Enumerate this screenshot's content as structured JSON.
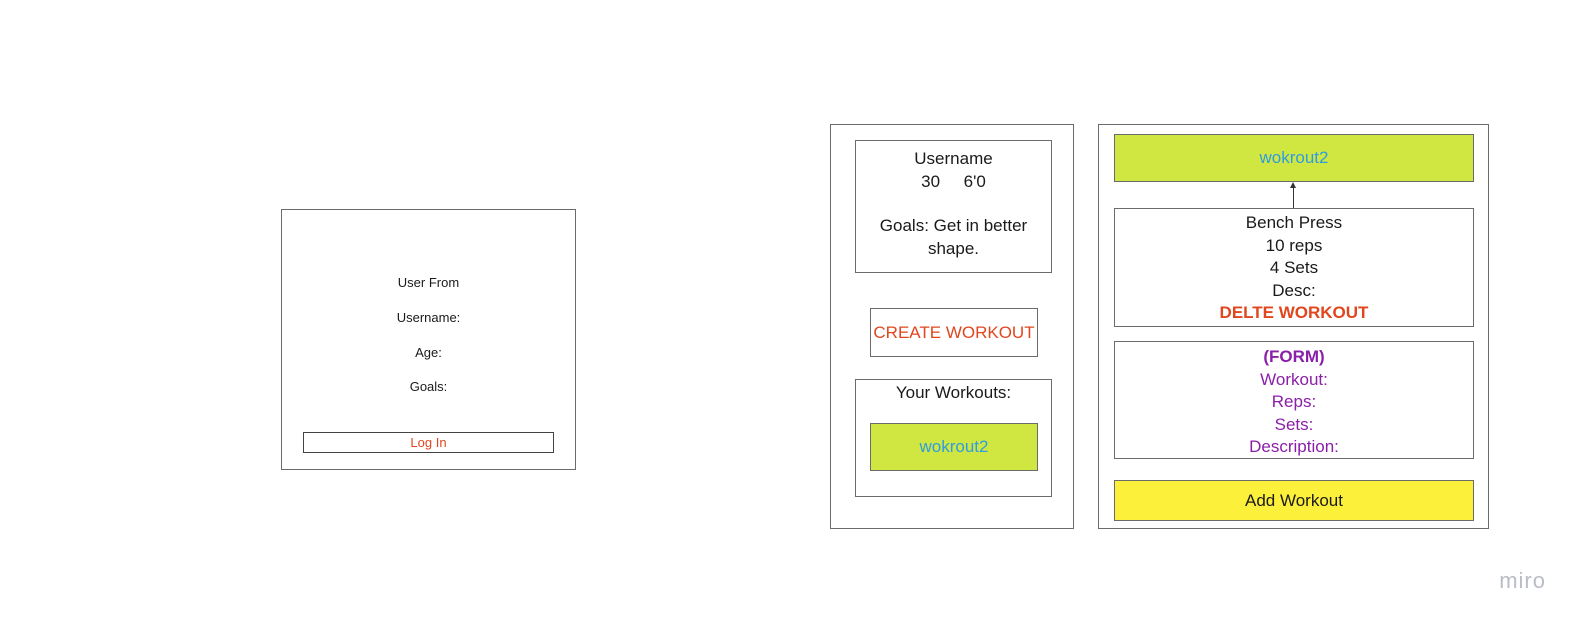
{
  "login_form": {
    "title": "User From",
    "username_label": "Username:",
    "age_label": "Age:",
    "goals_label": "Goals:",
    "login_button": "Log In"
  },
  "profile_panel": {
    "username": "Username",
    "age_height": "30     6'0",
    "goals": "Goals: Get in better shape.",
    "create_button": "CREATE WORKOUT",
    "workouts_title": "Your Workouts:",
    "workout_item": "wokrout2"
  },
  "detail_panel": {
    "workout_header": "wokrout2",
    "exercise": {
      "name": "Bench Press",
      "reps": "10 reps",
      "sets": "4 Sets",
      "desc": "Desc:",
      "delete_label": "DELTE WORKOUT"
    },
    "form": {
      "title": "(FORM)",
      "workout_label": "Workout:",
      "reps_label": "Reps:",
      "sets_label": "Sets:",
      "description_label": "Description:"
    },
    "add_button": "Add Workout"
  },
  "watermark": "miro",
  "colors": {
    "accent_red": "#e0471e",
    "chip_green": "#d1e741",
    "chip_text_blue": "#2e9de0",
    "form_purple": "#8a1fa8",
    "add_yellow": "#fdf03b"
  }
}
